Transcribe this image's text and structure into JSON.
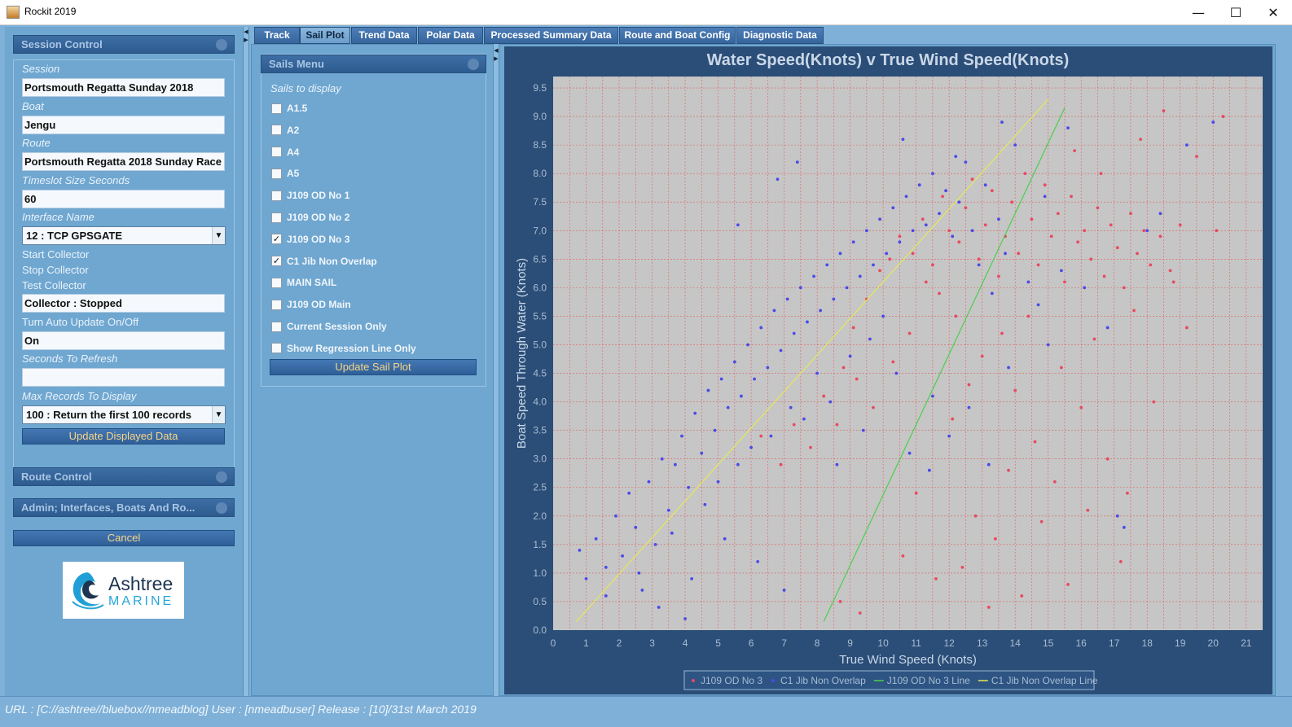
{
  "window": {
    "title": "Rockit 2019",
    "minimize": "—",
    "maximize": "☐",
    "close": "✕"
  },
  "session_control": {
    "header": "Session Control",
    "session_label": "Session",
    "session_value": "Portsmouth Regatta Sunday  2018",
    "boat_label": "Boat",
    "boat_value": "Jengu",
    "route_label": "Route",
    "route_value": "Portsmouth Regatta 2018 Sunday Race",
    "timeslot_label": "Timeslot Size Seconds",
    "timeslot_value": "60",
    "interface_label": "Interface Name",
    "interface_value": "12 : TCP GPSGATE",
    "start_collector": "Start Collector",
    "stop_collector": "Stop Collector",
    "test_collector": "Test Collector",
    "collector_status": "Collector : Stopped",
    "auto_update_label": "Turn Auto Update On/Off",
    "auto_update_value": "On",
    "refresh_label": "Seconds To Refresh",
    "refresh_value": "",
    "max_records_label": "Max Records To Display",
    "max_records_value": "100 : Return the first 100 records",
    "update_button": "Update Displayed Data"
  },
  "route_control": {
    "header": "Route Control"
  },
  "admin": {
    "header": "Admin; Interfaces, Boats And Ro..."
  },
  "cancel_button": "Cancel",
  "logo": {
    "line1": "Ashtree",
    "line2": "MARINE"
  },
  "tabs": [
    {
      "label": "Track",
      "active": false
    },
    {
      "label": "Sail Plot",
      "active": true
    },
    {
      "label": "Trend Data",
      "active": false
    },
    {
      "label": "Polar Data",
      "active": false
    },
    {
      "label": "Processed Summary Data",
      "active": false
    },
    {
      "label": "Route and Boat Config",
      "active": false
    },
    {
      "label": "Diagnostic Data",
      "active": false
    }
  ],
  "sails_menu": {
    "header": "Sails Menu",
    "subtitle": "Sails to display",
    "items": [
      {
        "label": "A1.5",
        "checked": false
      },
      {
        "label": "A2",
        "checked": false
      },
      {
        "label": "A4",
        "checked": false
      },
      {
        "label": "A5",
        "checked": false
      },
      {
        "label": "J109 OD No 1",
        "checked": false
      },
      {
        "label": "J109 OD No 2",
        "checked": false
      },
      {
        "label": "J109 OD No 3",
        "checked": true
      },
      {
        "label": "C1 Jib Non Overlap",
        "checked": true
      },
      {
        "label": "MAIN SAIL",
        "checked": false
      },
      {
        "label": "J109 OD Main",
        "checked": false
      },
      {
        "label": "Current Session Only",
        "checked": false
      },
      {
        "label": "Show Regression Line Only",
        "checked": false
      }
    ],
    "check_mark": "✓",
    "update_button": "Update Sail Plot"
  },
  "chart_data": {
    "type": "scatter",
    "title": "Water Speed(Knots) v True Wind Speed(Knots)",
    "xlabel": "True Wind Speed (Knots)",
    "ylabel": "Boat Speed Through Water (Knots)",
    "xlim": [
      0,
      21.5
    ],
    "ylim": [
      0,
      9.7
    ],
    "xticks": [
      "0",
      "1",
      "2",
      "3",
      "4",
      "5",
      "6",
      "7",
      "8",
      "9",
      "10",
      "11",
      "12",
      "13",
      "14",
      "15",
      "16",
      "17",
      "18",
      "19",
      "20",
      "21"
    ],
    "yticks": [
      "0.0",
      "0.5",
      "1.0",
      "1.5",
      "2.0",
      "2.5",
      "3.0",
      "3.5",
      "4.0",
      "4.5",
      "5.0",
      "5.5",
      "6.0",
      "6.5",
      "7.0",
      "7.5",
      "8.0",
      "8.5",
      "9.0",
      "9.5"
    ],
    "grid": true,
    "legend_position": "bottom",
    "series": [
      {
        "name": "J109 OD No 3",
        "kind": "scatter",
        "color": "#e84a5f",
        "points": [
          [
            8.2,
            4.1
          ],
          [
            8.8,
            4.6
          ],
          [
            9.1,
            5.3
          ],
          [
            9.5,
            5.8
          ],
          [
            9.9,
            6.3
          ],
          [
            10.2,
            6.5
          ],
          [
            10.5,
            6.9
          ],
          [
            10.9,
            6.6
          ],
          [
            11.2,
            7.2
          ],
          [
            11.5,
            6.4
          ],
          [
            11.8,
            7.6
          ],
          [
            12.0,
            7.0
          ],
          [
            12.3,
            6.8
          ],
          [
            12.5,
            7.4
          ],
          [
            12.7,
            7.9
          ],
          [
            12.9,
            6.5
          ],
          [
            13.1,
            7.1
          ],
          [
            13.3,
            7.7
          ],
          [
            13.5,
            6.2
          ],
          [
            13.7,
            6.9
          ],
          [
            13.9,
            7.5
          ],
          [
            14.1,
            6.6
          ],
          [
            14.3,
            8.0
          ],
          [
            14.5,
            7.2
          ],
          [
            14.7,
            6.4
          ],
          [
            14.9,
            7.8
          ],
          [
            15.1,
            6.9
          ],
          [
            15.3,
            7.3
          ],
          [
            15.5,
            6.1
          ],
          [
            15.7,
            7.6
          ],
          [
            15.9,
            6.8
          ],
          [
            16.1,
            7.0
          ],
          [
            16.3,
            6.5
          ],
          [
            16.5,
            7.4
          ],
          [
            16.7,
            6.2
          ],
          [
            16.9,
            7.1
          ],
          [
            17.1,
            6.7
          ],
          [
            17.3,
            6.0
          ],
          [
            17.5,
            7.3
          ],
          [
            17.7,
            6.6
          ],
          [
            17.9,
            7.0
          ],
          [
            18.1,
            6.4
          ],
          [
            18.4,
            6.9
          ],
          [
            18.7,
            6.3
          ],
          [
            19.0,
            7.1
          ],
          [
            19.5,
            8.3
          ],
          [
            20.1,
            7.0
          ],
          [
            20.3,
            9.0
          ],
          [
            18.5,
            9.1
          ],
          [
            17.8,
            8.6
          ],
          [
            16.6,
            8.0
          ],
          [
            15.8,
            8.4
          ],
          [
            14.4,
            5.5
          ],
          [
            13.6,
            5.2
          ],
          [
            13.0,
            4.8
          ],
          [
            12.6,
            4.3
          ],
          [
            12.2,
            5.5
          ],
          [
            11.7,
            5.9
          ],
          [
            11.3,
            6.1
          ],
          [
            10.8,
            5.2
          ],
          [
            10.3,
            4.7
          ],
          [
            9.7,
            3.9
          ],
          [
            9.2,
            4.4
          ],
          [
            8.6,
            3.6
          ],
          [
            7.8,
            3.2
          ],
          [
            7.3,
            3.6
          ],
          [
            6.9,
            2.9
          ],
          [
            6.3,
            3.4
          ],
          [
            13.8,
            2.8
          ],
          [
            14.6,
            3.3
          ],
          [
            15.2,
            2.6
          ],
          [
            16.0,
            3.9
          ],
          [
            16.8,
            3.0
          ],
          [
            17.4,
            2.4
          ],
          [
            14.8,
            1.9
          ],
          [
            13.4,
            1.6
          ],
          [
            12.4,
            1.1
          ],
          [
            11.6,
            0.9
          ],
          [
            10.6,
            1.3
          ],
          [
            14.2,
            0.6
          ],
          [
            15.6,
            0.8
          ],
          [
            17.2,
            1.2
          ],
          [
            18.2,
            4.0
          ],
          [
            19.2,
            5.3
          ],
          [
            12.8,
            2.0
          ],
          [
            11.0,
            2.4
          ],
          [
            15.4,
            4.6
          ],
          [
            16.4,
            5.1
          ],
          [
            17.6,
            5.6
          ],
          [
            18.8,
            6.1
          ],
          [
            14.0,
            4.2
          ],
          [
            12.1,
            3.7
          ],
          [
            16.2,
            2.1
          ],
          [
            13.2,
            0.4
          ],
          [
            9.3,
            0.3
          ],
          [
            8.7,
            0.5
          ]
        ]
      },
      {
        "name": "C1 Jib Non Overlap",
        "kind": "scatter",
        "color": "#4a4ae8",
        "points": [
          [
            0.8,
            1.4
          ],
          [
            1.0,
            0.9
          ],
          [
            1.3,
            1.6
          ],
          [
            1.6,
            1.1
          ],
          [
            1.9,
            2.0
          ],
          [
            2.1,
            1.3
          ],
          [
            2.3,
            2.4
          ],
          [
            2.5,
            1.8
          ],
          [
            2.7,
            0.7
          ],
          [
            2.9,
            2.6
          ],
          [
            3.1,
            1.5
          ],
          [
            3.3,
            3.0
          ],
          [
            3.5,
            2.1
          ],
          [
            3.7,
            2.9
          ],
          [
            3.9,
            3.4
          ],
          [
            4.1,
            2.5
          ],
          [
            4.3,
            3.8
          ],
          [
            4.5,
            3.1
          ],
          [
            4.7,
            4.2
          ],
          [
            4.9,
            3.5
          ],
          [
            5.1,
            4.4
          ],
          [
            5.3,
            3.9
          ],
          [
            5.5,
            4.7
          ],
          [
            5.7,
            4.1
          ],
          [
            5.9,
            5.0
          ],
          [
            6.1,
            4.4
          ],
          [
            6.3,
            5.3
          ],
          [
            6.5,
            4.6
          ],
          [
            6.7,
            5.6
          ],
          [
            6.9,
            4.9
          ],
          [
            7.1,
            5.8
          ],
          [
            7.3,
            5.2
          ],
          [
            7.5,
            6.0
          ],
          [
            7.7,
            5.4
          ],
          [
            7.9,
            6.2
          ],
          [
            8.1,
            5.6
          ],
          [
            8.3,
            6.4
          ],
          [
            8.5,
            5.8
          ],
          [
            8.7,
            6.6
          ],
          [
            8.9,
            6.0
          ],
          [
            9.1,
            6.8
          ],
          [
            9.3,
            6.2
          ],
          [
            9.5,
            7.0
          ],
          [
            9.7,
            6.4
          ],
          [
            9.9,
            7.2
          ],
          [
            10.1,
            6.6
          ],
          [
            10.3,
            7.4
          ],
          [
            10.5,
            6.8
          ],
          [
            10.7,
            7.6
          ],
          [
            10.9,
            7.0
          ],
          [
            11.1,
            7.8
          ],
          [
            11.3,
            7.1
          ],
          [
            11.5,
            8.0
          ],
          [
            11.7,
            7.3
          ],
          [
            11.9,
            7.7
          ],
          [
            12.1,
            6.9
          ],
          [
            12.3,
            7.5
          ],
          [
            12.5,
            8.2
          ],
          [
            12.7,
            7.0
          ],
          [
            12.9,
            6.4
          ],
          [
            13.1,
            7.8
          ],
          [
            13.3,
            5.9
          ],
          [
            13.5,
            7.2
          ],
          [
            13.7,
            6.6
          ],
          [
            14.0,
            8.5
          ],
          [
            14.4,
            6.1
          ],
          [
            15.0,
            5.0
          ],
          [
            15.4,
            6.3
          ],
          [
            17.1,
            2.0
          ],
          [
            17.3,
            1.8
          ],
          [
            14.7,
            5.7
          ],
          [
            16.1,
            6.0
          ],
          [
            18.0,
            7.0
          ],
          [
            18.4,
            7.3
          ],
          [
            19.2,
            8.5
          ],
          [
            20.0,
            8.9
          ],
          [
            15.6,
            8.8
          ],
          [
            12.0,
            3.4
          ],
          [
            11.5,
            4.1
          ],
          [
            10.4,
            4.5
          ],
          [
            9.0,
            4.8
          ],
          [
            8.4,
            4.0
          ],
          [
            7.6,
            3.7
          ],
          [
            6.6,
            3.4
          ],
          [
            5.6,
            2.9
          ],
          [
            4.6,
            2.2
          ],
          [
            3.6,
            1.7
          ],
          [
            2.6,
            1.0
          ],
          [
            1.6,
            0.6
          ],
          [
            7.0,
            0.7
          ],
          [
            6.2,
            1.2
          ],
          [
            5.2,
            1.6
          ],
          [
            4.2,
            0.9
          ],
          [
            3.2,
            0.4
          ],
          [
            4.0,
            0.2
          ],
          [
            9.6,
            5.1
          ],
          [
            10.0,
            5.5
          ],
          [
            8.0,
            4.5
          ],
          [
            7.2,
            3.9
          ],
          [
            6.0,
            3.2
          ],
          [
            5.0,
            2.6
          ],
          [
            12.6,
            3.9
          ],
          [
            13.2,
            2.9
          ],
          [
            13.8,
            4.6
          ],
          [
            11.4,
            2.8
          ],
          [
            10.8,
            3.1
          ],
          [
            9.4,
            3.5
          ],
          [
            8.6,
            2.9
          ],
          [
            6.8,
            7.9
          ],
          [
            5.6,
            7.1
          ],
          [
            7.4,
            8.2
          ],
          [
            13.6,
            8.9
          ],
          [
            12.2,
            8.3
          ],
          [
            10.6,
            8.6
          ],
          [
            14.9,
            7.6
          ],
          [
            16.8,
            5.3
          ]
        ]
      },
      {
        "name": "J109 OD No 3 Line",
        "kind": "line",
        "color": "#4ccf4c",
        "points": [
          [
            8.2,
            0.15
          ],
          [
            15.5,
            9.15
          ]
        ]
      },
      {
        "name": "C1 Jib Non Overlap Line",
        "kind": "line",
        "color": "#e6e85a",
        "points": [
          [
            0.7,
            0.15
          ],
          [
            15.0,
            9.3
          ]
        ]
      }
    ]
  },
  "status_bar": "URL :  [C://ashtree//bluebox//nmeadblog] User : [nmeadbuser] Release : [10]/31st March 2019"
}
